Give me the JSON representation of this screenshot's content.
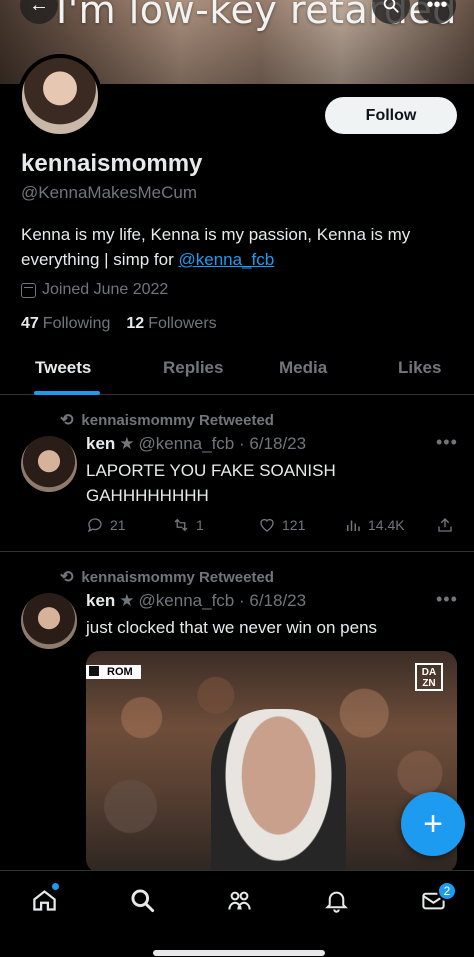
{
  "header": {
    "banner_text": "I'm low-key retarded",
    "back_icon": "arrow-left-icon",
    "search_icon": "search-icon",
    "more_icon": "more-icon"
  },
  "profile": {
    "follow_label": "Follow",
    "display_name": "kennaismommy",
    "handle": "@KennaMakesMeCum",
    "bio_text": "Kenna is my life, Kenna is my passion, Kenna is my everything | simp for ",
    "bio_link": "@kenna_fcb",
    "joined": "Joined June 2022",
    "following_count": "47",
    "following_label": "Following",
    "followers_count": "12",
    "followers_label": "Followers"
  },
  "tabs": [
    {
      "label": "Tweets",
      "active": true
    },
    {
      "label": "Replies",
      "active": false
    },
    {
      "label": "Media",
      "active": false
    },
    {
      "label": "Likes",
      "active": false
    }
  ],
  "tweets": [
    {
      "retweet_label": "kennaismommy Retweeted",
      "author": "ken",
      "author_emoji": "★",
      "handle_date": "@kenna_fcb · 6/18/23",
      "text": "LAPORTE YOU FAKE SOANISH GAHHHHHHHH",
      "replies": "21",
      "retweets": "1",
      "likes": "121",
      "views": "14.4K"
    },
    {
      "retweet_label": "kennaismommy Retweeted",
      "author": "ken",
      "author_emoji": "★",
      "handle_date": "@kenna_fcb · 6/18/23",
      "text": "just clocked that we never win on pens",
      "media_tag": "ROM",
      "media_watermark": "DA ZN"
    }
  ],
  "fab": {
    "label": "+"
  },
  "nav": {
    "items": [
      "home-icon",
      "search-icon",
      "communities-icon",
      "notifications-icon",
      "messages-icon"
    ],
    "messages_badge": "2"
  },
  "colors": {
    "accent": "#1d9bf0",
    "background": "#000000",
    "muted": "#71767b"
  }
}
